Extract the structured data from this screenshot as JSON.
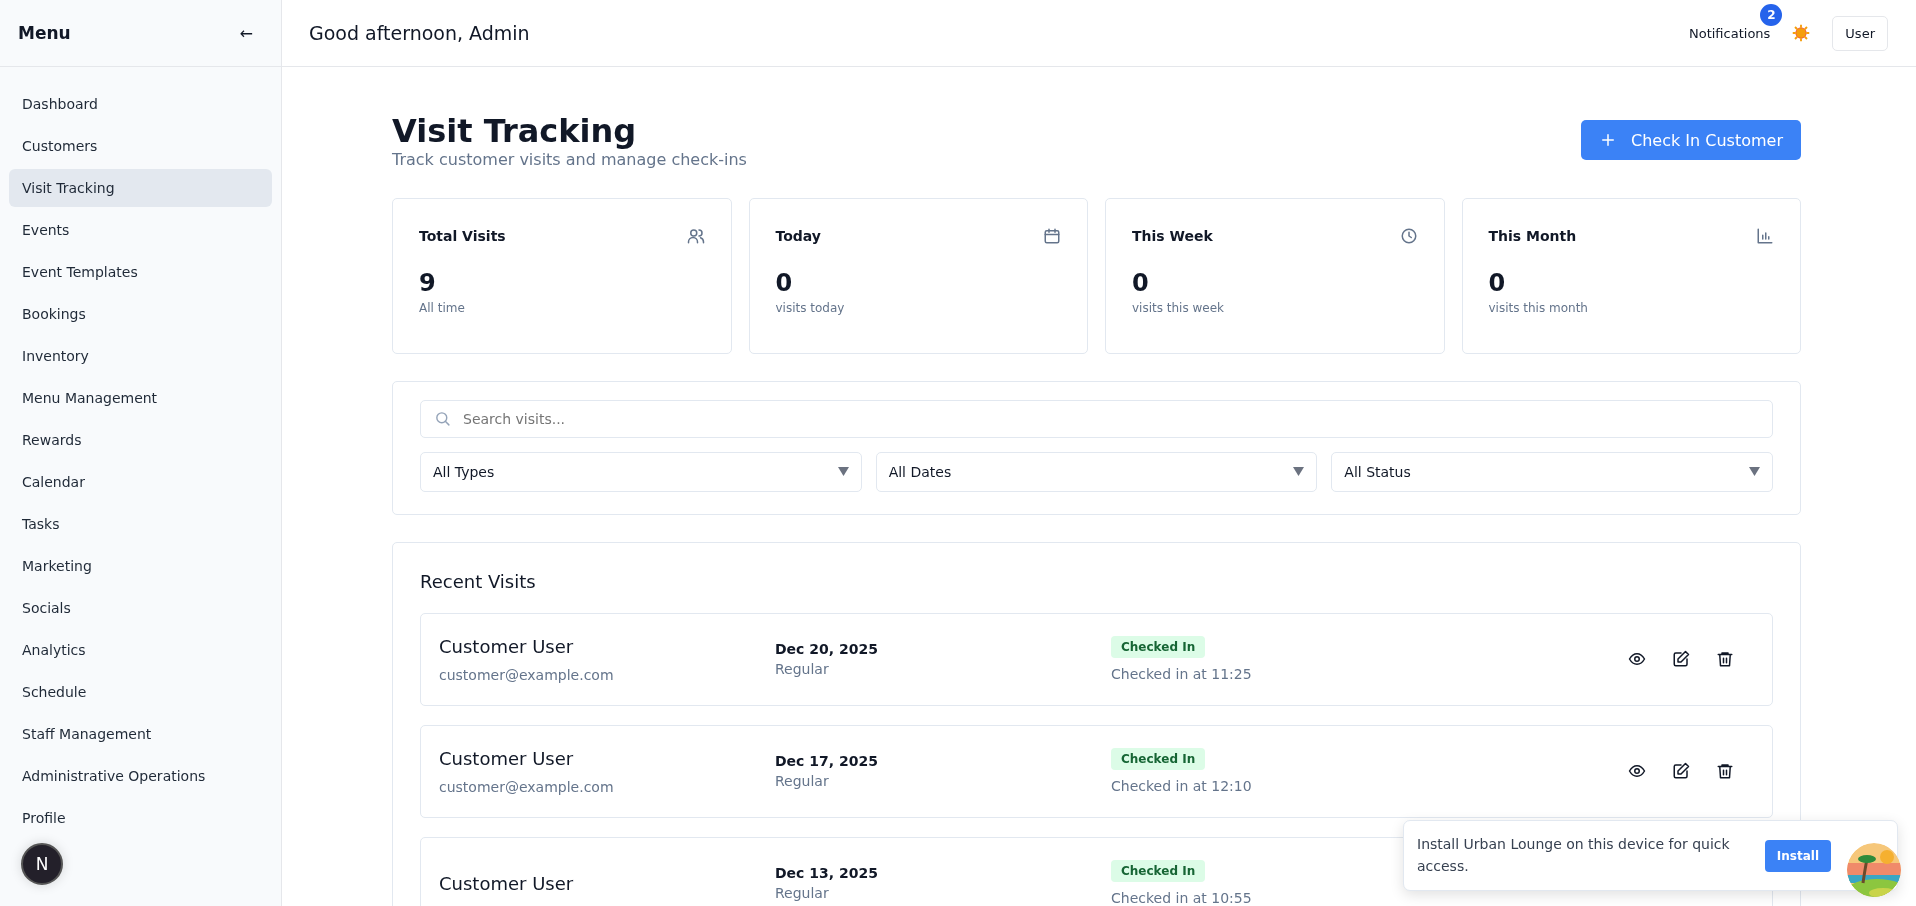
{
  "sidebar": {
    "title": "Menu",
    "collapse_glyph": "←",
    "items": [
      {
        "label": "Dashboard",
        "selected": false
      },
      {
        "label": "Customers",
        "selected": false
      },
      {
        "label": "Visit Tracking",
        "selected": true
      },
      {
        "label": "Events",
        "selected": false
      },
      {
        "label": "Event Templates",
        "selected": false
      },
      {
        "label": "Bookings",
        "selected": false
      },
      {
        "label": "Inventory",
        "selected": false
      },
      {
        "label": "Menu Management",
        "selected": false
      },
      {
        "label": "Rewards",
        "selected": false
      },
      {
        "label": "Calendar",
        "selected": false
      },
      {
        "label": "Tasks",
        "selected": false
      },
      {
        "label": "Marketing",
        "selected": false
      },
      {
        "label": "Socials",
        "selected": false
      },
      {
        "label": "Analytics",
        "selected": false
      },
      {
        "label": "Schedule",
        "selected": false
      },
      {
        "label": "Staff Management",
        "selected": false
      },
      {
        "label": "Administrative Operations",
        "selected": false
      },
      {
        "label": "Profile",
        "selected": false
      }
    ]
  },
  "header": {
    "greeting": "Good afternoon, Admin",
    "notifications": {
      "label": "Notifications",
      "count": "2"
    },
    "user_button": "User"
  },
  "page": {
    "title": "Visit Tracking",
    "subtitle": "Track customer visits and manage check-ins",
    "primary_button": "Check In Customer"
  },
  "stats": [
    {
      "title": "Total Visits",
      "value": "9",
      "caption": "All time"
    },
    {
      "title": "Today",
      "value": "0",
      "caption": "visits today"
    },
    {
      "title": "This Week",
      "value": "0",
      "caption": "visits this week"
    },
    {
      "title": "This Month",
      "value": "0",
      "caption": "visits this month"
    }
  ],
  "filters": {
    "search": {
      "placeholder": "Search visits..."
    },
    "selects": [
      "All Types",
      "All Dates",
      "All Status"
    ]
  },
  "recent_visits": {
    "title": "Recent Visits",
    "rows": [
      {
        "name": "Customer User",
        "email": "customer@example.com",
        "date": "Dec 20, 2025",
        "type": "Regular",
        "status": "Checked In",
        "note": "Checked in at 11:25"
      },
      {
        "name": "Customer User",
        "email": "customer@example.com",
        "date": "Dec 17, 2025",
        "type": "Regular",
        "status": "Checked In",
        "note": "Checked in at 12:10"
      },
      {
        "name": "Customer User",
        "date": "Dec 13, 2025",
        "type": "Regular",
        "status": "Checked In",
        "note": "Checked in at 10:55"
      }
    ]
  },
  "install_prompt": {
    "text": "Install Urban Lounge on this device for quick access.",
    "button": "Install"
  },
  "dev_badge": "N"
}
